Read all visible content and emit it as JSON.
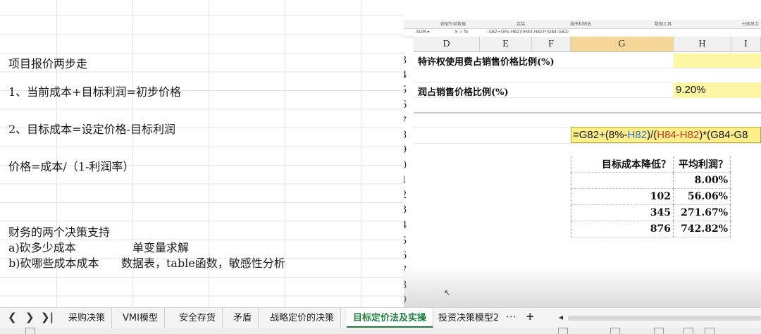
{
  "notes": [
    {
      "text": "项目报价两步走"
    },
    {
      "text": "1、当前成本+目标利润=初步价格"
    },
    {
      "text": "2、目标成本=设定价格-目标利润"
    },
    {
      "text": "价格=成本/（1-利润率）"
    },
    {
      "text": "财务的两个决策支持"
    },
    {
      "a": "a)砍多少成本",
      "b": "单变量求解"
    },
    {
      "a": "b)砍哪些成本成本",
      "b": "数据表，table函数，敏感性分析"
    }
  ],
  "excel": {
    "ribbon": [
      "获取外部数据",
      "连接",
      "排序和筛选",
      "数据工具",
      "分级显示"
    ],
    "formula_bar": "-G82+(8%-H82)/(H84-H82)*(G84-G82)",
    "columns": [
      "D",
      "E",
      "F",
      "G",
      "H",
      "I"
    ],
    "rows": [
      "3",
      "4",
      "5",
      "6",
      "7",
      "8",
      "9",
      "0",
      "1",
      "2",
      "3",
      "4",
      "5",
      "6",
      "7",
      "8",
      "9"
    ],
    "label_row3": "特许权使用费占销售价格比例(%)",
    "label_row5": "润占销售价格比例(%)",
    "h5_value": "9.20%",
    "formula_parts": [
      "=G82+(8%-",
      "H82",
      ")/(",
      "H84-H82",
      ")*(G84-G8"
    ],
    "table": {
      "headers": [
        "目标成本降低？",
        "平均利润？"
      ],
      "rows": [
        [
          "",
          "8.00%"
        ],
        [
          "102",
          "56.06%"
        ],
        [
          "345",
          "271.67%"
        ],
        [
          "876",
          "742.82%"
        ]
      ]
    }
  },
  "tabs": {
    "nav": [
      "❮",
      "❯",
      "❯|"
    ],
    "sheets": [
      "采购决策",
      "VMI模型",
      "安全存货",
      "矛盾",
      "战略定价的决策",
      "目标定价法及实操",
      "投资决策模型2"
    ],
    "active": "目标定价法及实操",
    "more": "⋯",
    "add": "+",
    "scroll_left": "◂"
  },
  "colors": {
    "accent": "#1e7e3e",
    "highlight": "#fdf7a3"
  }
}
